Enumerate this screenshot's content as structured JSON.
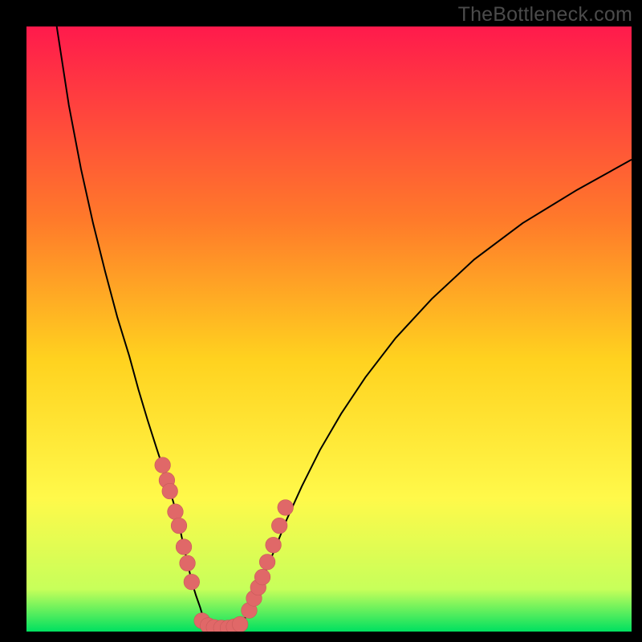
{
  "watermark": "TheBottleneck.com",
  "colors": {
    "frame": "#000000",
    "gradient_top": "#ff1a4c",
    "gradient_mid1": "#ff7a2a",
    "gradient_mid2": "#ffd21f",
    "gradient_mid3": "#fff94a",
    "gradient_low": "#c7ff5a",
    "gradient_bottom": "#00e060",
    "curve": "#000000",
    "marker_fill": "#e06868",
    "marker_stroke": "#c85a5a"
  },
  "chart_data": {
    "type": "line",
    "title": "",
    "xlabel": "",
    "ylabel": "",
    "xlim": [
      0,
      100
    ],
    "ylim": [
      0,
      100
    ],
    "curve_left": {
      "name": "left-branch",
      "x": [
        5,
        7,
        9,
        11,
        13,
        15,
        17,
        18.5,
        20,
        21.5,
        23,
        24.3,
        25.3,
        26,
        26.7,
        27.3,
        28,
        28.7,
        29.3,
        30
      ],
      "y": [
        100,
        87,
        76.5,
        67.5,
        59.5,
        52,
        45.5,
        40,
        35,
        30.3,
        25.7,
        21.3,
        17.3,
        14,
        11,
        8.3,
        6,
        4,
        2,
        0.7
      ]
    },
    "curve_valley": {
      "name": "valley",
      "x": [
        30,
        31,
        32,
        33,
        34,
        35
      ],
      "y": [
        0.7,
        0.3,
        0.2,
        0.2,
        0.3,
        0.7
      ]
    },
    "curve_right": {
      "name": "right-branch",
      "x": [
        35,
        36,
        37,
        38,
        39.3,
        41,
        43,
        45.5,
        48.5,
        52,
        56,
        61,
        67,
        74,
        82,
        91,
        100
      ],
      "y": [
        0.7,
        2,
        4,
        6.5,
        9.5,
        13.5,
        18.5,
        24,
        30,
        36,
        42,
        48.5,
        55,
        61.5,
        67.5,
        73,
        78
      ]
    },
    "markers_left": {
      "name": "left-cluster",
      "x": [
        22.5,
        23.2,
        23.7,
        24.6,
        25.2,
        26.0,
        26.6,
        27.3
      ],
      "y": [
        27.5,
        25.0,
        23.2,
        19.8,
        17.5,
        14.0,
        11.3,
        8.2
      ]
    },
    "markers_bottom": {
      "name": "bottom-cluster",
      "x": [
        29.0,
        30.0,
        31.0,
        32.2,
        33.3,
        34.3,
        35.3
      ],
      "y": [
        1.8,
        1.0,
        0.7,
        0.6,
        0.6,
        0.8,
        1.2
      ]
    },
    "markers_right": {
      "name": "right-cluster",
      "x": [
        36.8,
        37.6,
        38.3,
        39.0,
        39.8,
        40.8,
        41.8,
        42.8
      ],
      "y": [
        3.5,
        5.5,
        7.3,
        9.0,
        11.5,
        14.3,
        17.5,
        20.5
      ]
    },
    "marker_radius": 1.3
  }
}
